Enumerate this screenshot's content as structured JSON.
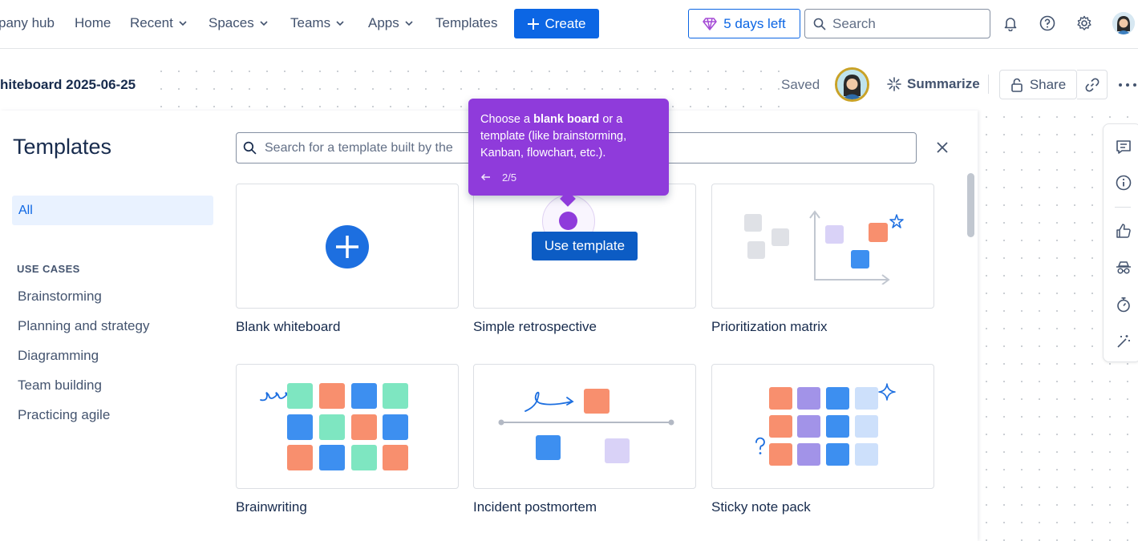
{
  "topnav": {
    "company_hub": "pany hub",
    "home": "Home",
    "recent": "Recent",
    "spaces": "Spaces",
    "teams": "Teams",
    "apps": "Apps",
    "templates": "Templates",
    "create": "Create",
    "trial": "5 days left",
    "search_placeholder": "Search"
  },
  "board": {
    "title": "hiteboard 2025-06-25",
    "saved": "Saved",
    "summarize": "Summarize",
    "share": "Share"
  },
  "panel": {
    "title": "Templates",
    "search_placeholder": "Search for a template built by the",
    "categories": {
      "all": "All",
      "use_cases_heading": "USE CASES",
      "items": [
        "Brainstorming",
        "Planning and strategy",
        "Diagramming",
        "Team building",
        "Practicing agile"
      ]
    },
    "cards": [
      {
        "label": "Blank whiteboard"
      },
      {
        "label": "Simple retrospective"
      },
      {
        "label": "Prioritization matrix"
      },
      {
        "label": "Brainwriting"
      },
      {
        "label": "Incident postmortem"
      },
      {
        "label": "Sticky note pack"
      }
    ],
    "use_template": "Use template"
  },
  "tooltip": {
    "text_before": "Choose a ",
    "text_bold": "blank board",
    "text_after": " or a template (like brainstorming, Kanban, flowchart, etc.).",
    "step": "2/5"
  },
  "colors": {
    "accent": "#0c66e4",
    "tooltip": "#8f3bdb",
    "salmon": "#f88f6e",
    "blue": "#3d8ff0",
    "green": "#7ee6c1",
    "lavender": "#a293e8",
    "light_lavender": "#d9d2f7",
    "light_blue": "#cde0fb",
    "gray_sq": "#dfe1e6"
  }
}
